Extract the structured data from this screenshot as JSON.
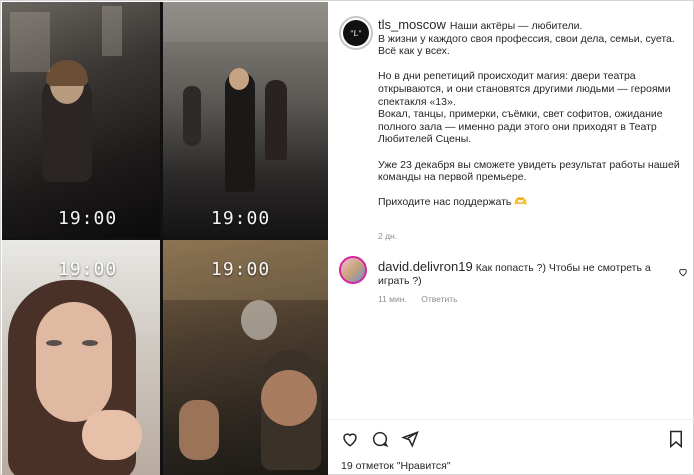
{
  "media": {
    "tiles": [
      {
        "time": "19:00"
      },
      {
        "time": "19:00"
      },
      {
        "time": "19:00"
      },
      {
        "time": "19:00"
      }
    ]
  },
  "post": {
    "avatar_text": "\"L\"",
    "username": "tls_moscow",
    "caption": [
      "Наши актёры — любители.",
      "В жизни у каждого своя профессия, свои дела, семьи, суета. Всё как у всех.",
      "",
      "Но в дни репетиций происходит магия: двери театра открываются, и они становятся другими людьми — героями спектакля «13».",
      "Вокал, танцы, примерки, съёмки, свет софитов, ожидание полного зала — именно ради этого они приходят в Театр Любителей Сцены.",
      "",
      "Уже 23 декабря вы сможете увидеть результат работы нашей команды на первой премьере.",
      "",
      "Приходите нас поддержать 🫶"
    ],
    "age": "2 дн."
  },
  "comment": {
    "username": "david.delivron19",
    "text": "Как попасть ?) Чтобы не смотреть а играть ?)",
    "age": "11 мин.",
    "reply_label": "Ответить"
  },
  "likes_text": "19 отметок \"Нравится\"",
  "icons": [
    "more-icon",
    "heart-icon",
    "comment-icon",
    "share-icon",
    "bookmark-icon",
    "small-heart-icon"
  ]
}
